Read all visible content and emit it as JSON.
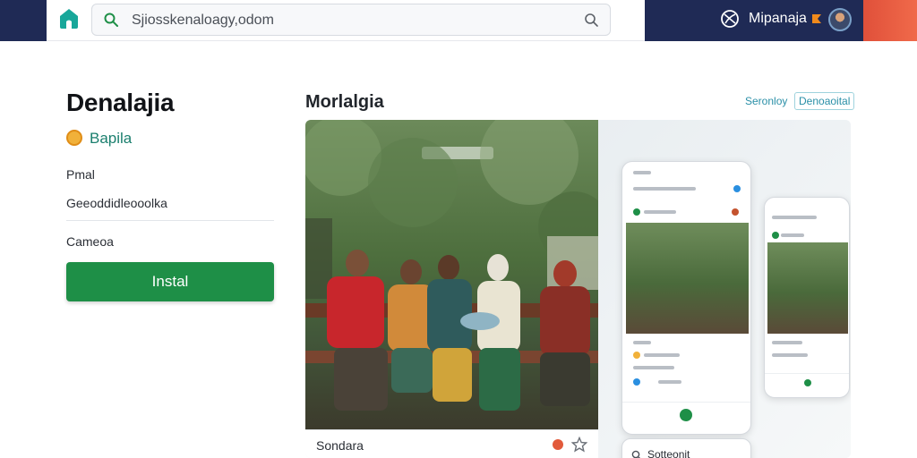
{
  "search": {
    "value": "Sjiosskenaloagy,odom"
  },
  "header": {
    "username": "Mipanaja"
  },
  "app": {
    "title": "Denalajia",
    "developer": "Bapila",
    "meta_1": "Pmal",
    "meta_2": "Geeoddidleooolka",
    "meta_3": "Cameoa",
    "install_label": "Instal"
  },
  "section": {
    "title": "Morlalgia",
    "link_a": "Seronloy",
    "link_b": "Denoaoital"
  },
  "gallery": {
    "caption": "Sondara",
    "phone_c_label": "Sotteonit"
  },
  "colors": {
    "topbar": "#1f2a55",
    "install": "#1e8f47",
    "link": "#2a8fa7",
    "developer": "#1b7f6e"
  },
  "icons": [
    "app-logo-icon",
    "search-icon",
    "search-end-icon",
    "globe-icon",
    "flag-icon",
    "star-icon"
  ]
}
